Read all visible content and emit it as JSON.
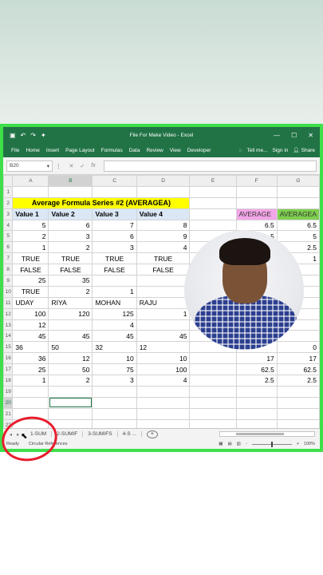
{
  "window": {
    "title": "File For Make Video - Excel",
    "min": "—",
    "max": "☐",
    "close": "✕"
  },
  "ribbon": {
    "tabs": [
      "File",
      "Home",
      "Insert",
      "Page Layout",
      "Formulas",
      "Data",
      "Review",
      "View",
      "Developer"
    ],
    "tell_me": "Tell me...",
    "sign_in": "Sign in",
    "share": "Share"
  },
  "formula_bar": {
    "name_box": "B20",
    "cancel": "✕",
    "enter": "✓",
    "fx": "fx"
  },
  "sheet": {
    "columns": [
      "A",
      "B",
      "C",
      "D",
      "E",
      "F",
      "G"
    ],
    "title": "Average Formula Series #2 (AVERAGEA)",
    "headers": [
      "Value 1",
      "Value 2",
      "Value 3",
      "Value 4"
    ],
    "label_average": "AVERAGE",
    "label_averagea": "AVERAGEA",
    "rows": [
      {
        "n": "1"
      },
      {
        "n": "2"
      },
      {
        "n": "3"
      },
      {
        "n": "4",
        "a": "5",
        "b": "6",
        "c": "7",
        "d": "8",
        "f": "6.5",
        "g": "6.5"
      },
      {
        "n": "5",
        "a": "2",
        "b": "3",
        "c": "6",
        "d": "9",
        "f": "5",
        "g": "5"
      },
      {
        "n": "6",
        "a": "1",
        "b": "2",
        "c": "3",
        "d": "4",
        "f": "2.5",
        "g": "2.5"
      },
      {
        "n": "7",
        "a": "TRUE",
        "b": "TRUE",
        "c": "TRUE",
        "d": "TRUE",
        "f": "",
        "g": "1"
      },
      {
        "n": "8",
        "a": "FALSE",
        "b": "FALSE",
        "c": "FALSE",
        "d": "FALSE",
        "f": "",
        "g": ""
      },
      {
        "n": "9",
        "a": "25",
        "b": "35",
        "c": "",
        "d": "",
        "f": "",
        "g": ""
      },
      {
        "n": "10",
        "a": "TRUE",
        "b": "2",
        "c": "1",
        "d": "",
        "f": "",
        "g": ""
      },
      {
        "n": "11",
        "a": "UDAY",
        "b": "RIYA",
        "c": "MOHAN",
        "d": "RAJU",
        "f": "",
        "g": ""
      },
      {
        "n": "12",
        "a": "100",
        "b": "120",
        "c": "125",
        "d": "1",
        "f": "",
        "g": ""
      },
      {
        "n": "13",
        "a": "12",
        "b": "",
        "c": "4",
        "d": "",
        "f": "",
        "g": ""
      },
      {
        "n": "14",
        "a": "45",
        "b": "45",
        "c": "45",
        "d": "45",
        "f": "",
        "g": ""
      },
      {
        "n": "15",
        "a": "36",
        "b": "50",
        "c": "32",
        "d": "12",
        "f": "",
        "g": "0"
      },
      {
        "n": "16",
        "a": "36",
        "b": "12",
        "c": "10",
        "d": "10",
        "f": "17",
        "g": "17"
      },
      {
        "n": "17",
        "a": "25",
        "b": "50",
        "c": "75",
        "d": "100",
        "f": "62.5",
        "g": "62.5"
      },
      {
        "n": "18",
        "a": "1",
        "b": "2",
        "c": "3",
        "d": "4",
        "f": "2.5",
        "g": "2.5"
      },
      {
        "n": "19"
      },
      {
        "n": "20"
      },
      {
        "n": "21"
      },
      {
        "n": "22"
      }
    ]
  },
  "tabs": {
    "nav_prev": "◂",
    "nav_next": "▸",
    "items": [
      "1-SUM",
      "2-SUMIF",
      "3-SUMIFS",
      "4-S ..."
    ],
    "add": "+"
  },
  "status": {
    "ready": "Ready",
    "circular": "Circular References",
    "zoom": "100%",
    "zoom_minus": "-",
    "zoom_plus": "+"
  }
}
